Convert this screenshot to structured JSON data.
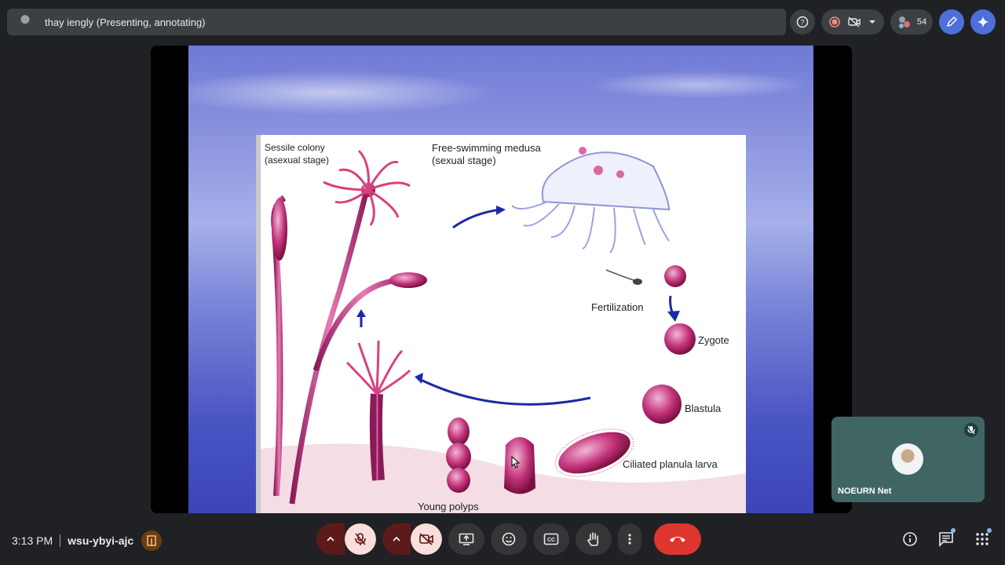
{
  "header": {
    "presenter_text": "thay iengly (Presenting, annotating)"
  },
  "top_controls": {
    "participant_count": "54"
  },
  "slide": {
    "labels": {
      "sessile": "Sessile colony",
      "sessile_sub": "(asexual stage)",
      "medusa": "Free-swimming medusa",
      "medusa_sub": "(sexual stage)",
      "fertilization": "Fertilization",
      "zygote": "Zygote",
      "blastula": "Blastula",
      "planula": "Ciliated planula larva",
      "young_polyps": "Young polyps"
    }
  },
  "self_tile": {
    "name": "NOEURN Net"
  },
  "footer": {
    "time": "3:13 PM",
    "meeting_code": "wsu-ybyi-ajc"
  },
  "colors": {
    "end_call": "#dc362e",
    "muted_bg": "#f9dedc",
    "tile_bg": "#3f6663"
  }
}
